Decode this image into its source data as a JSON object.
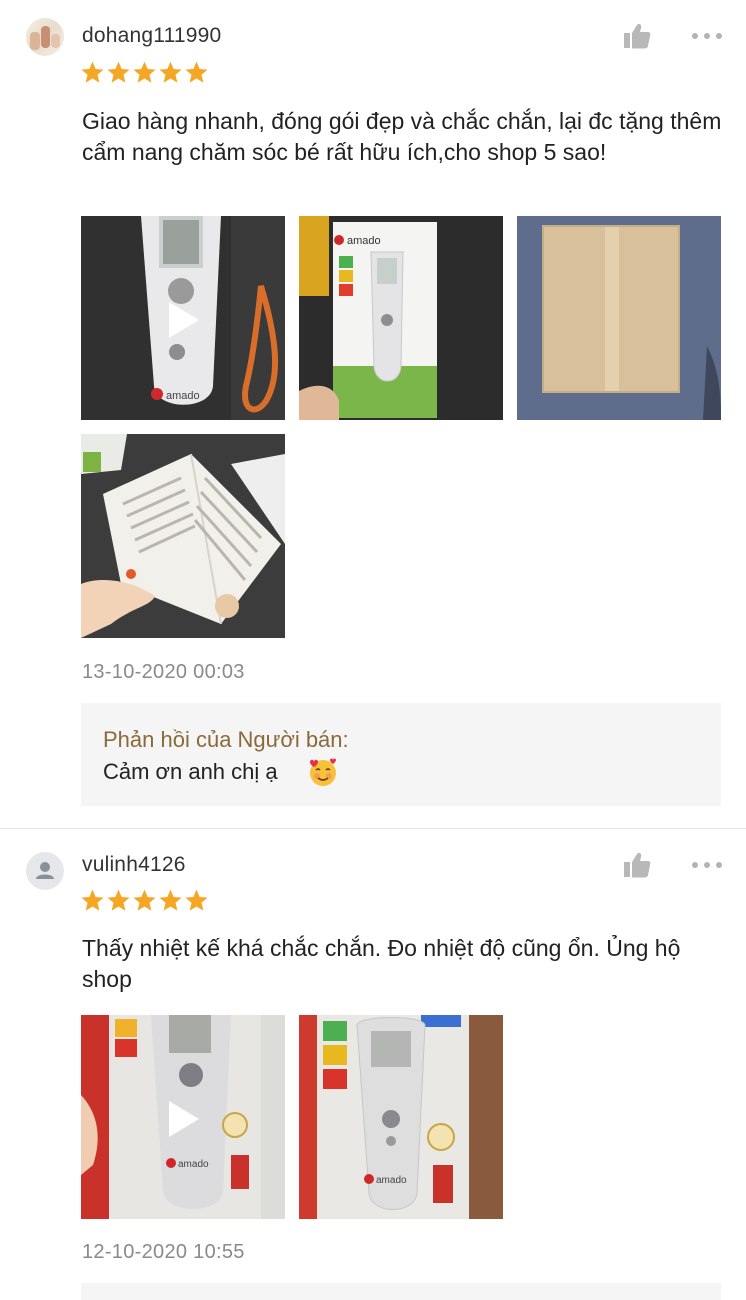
{
  "reviews": [
    {
      "username": "dohang111990",
      "rating": 5,
      "text": "Giao hàng nhanh, đóng gói đẹp và chắc chắn, lại đc tặng thêm cẩm nang chăm sóc bé rất hữu ích,cho shop 5 sao!",
      "timestamp": "13-10-2020 00:03",
      "media_labels": [
        "amado",
        "amado",
        "",
        ""
      ],
      "reply": {
        "title": "Phản hồi của Người bán:",
        "text": "Cảm ơn anh chị ạ"
      }
    },
    {
      "username": "vulinh4126",
      "rating": 5,
      "text": "Thấy nhiệt kế khá chắc chắn. Đo nhiệt độ cũng ổn. Ủng hộ shop",
      "timestamp": "12-10-2020 10:55",
      "media_labels": [
        "amado",
        "amado"
      ]
    }
  ],
  "colors": {
    "star": "#f5a623",
    "reply_title": "#8a6a3a",
    "timestamp": "#8a8a8a",
    "reply_bg": "#f5f5f5"
  },
  "icons": {
    "like": "thumbs-up-icon",
    "more": "more-dots-icon",
    "play": "play-icon",
    "reply_emoji": "smiling-face-with-hearts-emoji"
  }
}
